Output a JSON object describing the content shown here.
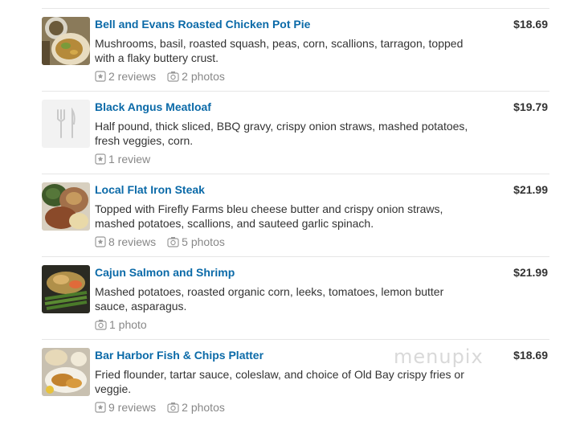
{
  "menu": {
    "items": [
      {
        "name": "Bell and Evans Roasted Chicken Pot Pie",
        "description": "Mushrooms, basil, roasted squash, peas, corn, scallions, tarragon, topped with a flaky buttery crust.",
        "price": "$18.69",
        "reviews": "2 reviews",
        "photos": "2 photos",
        "thumb_icon": "food-photo"
      },
      {
        "name": "Black Angus Meatloaf",
        "description": "Half pound, thick sliced, BBQ gravy, crispy onion straws, mashed potatoes, fresh veggies, corn.",
        "price": "$19.79",
        "reviews": "1 review",
        "photos": "",
        "thumb_icon": "fork-knife-icon"
      },
      {
        "name": "Local Flat Iron Steak",
        "description": "Topped with Firefly Farms bleu cheese butter and crispy onion straws, mashed potatoes, scallions, and sauteed garlic spinach.",
        "price": "$21.99",
        "reviews": "8 reviews",
        "photos": "5 photos",
        "thumb_icon": "food-photo"
      },
      {
        "name": "Cajun Salmon and Shrimp",
        "description": "Mashed potatoes, roasted organic corn, leeks, tomatoes, lemon butter sauce, asparagus.",
        "price": "$21.99",
        "reviews": "",
        "photos": "1 photo",
        "thumb_icon": "food-photo"
      },
      {
        "name": "Bar Harbor Fish & Chips Platter",
        "description": "Fried flounder, tartar sauce, coleslaw, and choice of Old Bay crispy fries or veggie.",
        "price": "$18.69",
        "reviews": "9 reviews",
        "photos": "2 photos",
        "thumb_icon": "food-photo"
      }
    ]
  },
  "watermark": "menupix",
  "colors": {
    "link": "#0b6aa8",
    "text": "#333333",
    "muted": "#888888",
    "divider": "#e6e6e6"
  }
}
